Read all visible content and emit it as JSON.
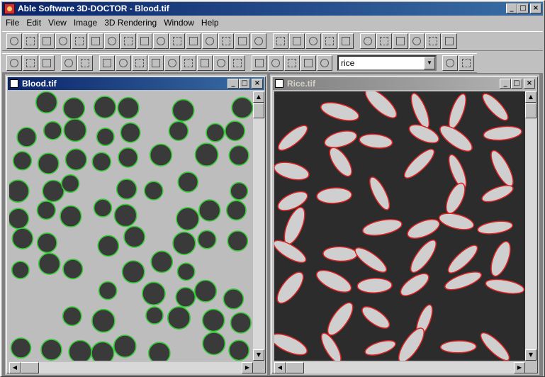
{
  "app": {
    "title": "Able Software 3D-DOCTOR - Blood.tif"
  },
  "window_buttons": {
    "minimize": "_",
    "maximize": "□",
    "close": "×"
  },
  "menu": [
    "File",
    "Edit",
    "View",
    "Image",
    "3D Rendering",
    "Window",
    "Help"
  ],
  "toolbar1": [
    "select-region-tool",
    "rectangle-tool",
    "ellipse-tool",
    "vertical-tool",
    "horizontal-tool",
    "polyline-tool",
    "move-tool",
    "transform-tool",
    "rectangle-select-tool",
    "polygon-edit-tool",
    "contour-edit-tool",
    "delete-tool",
    "erase-tool",
    "ruler-tool",
    "measure-tool",
    "edit-tool",
    "pencil-tool",
    "grid-tool",
    "fill-tool",
    "palette-tool",
    "table-tool",
    "region-select-tool",
    "pentagon-tool",
    "square-tool",
    "circle-tool",
    "remove-tool",
    "cursor-select-tool"
  ],
  "toolbar2": [
    "new-icon",
    "open-folder-icon",
    "save-icon",
    "edit-icon",
    "pointer-icon",
    "zoom-in-icon",
    "zoom-out-icon",
    "pan-icon",
    "arrow-left-icon",
    "arrow-right-icon",
    "arrow-up-icon",
    "arrow-down-icon",
    "undo-icon",
    "redo-icon",
    "segment-icon",
    "boundary-icon",
    "link-icon",
    "text-icon",
    "scale-icon"
  ],
  "object_selector": {
    "value": "rice",
    "arrow": "▼"
  },
  "toolbar2_after": [
    "object-settings-icon",
    "help-cursor-icon"
  ],
  "windows": [
    {
      "title": "Blood.tif",
      "state": "active",
      "outline_color": "#33cc33",
      "background": "#bdbdbd",
      "cell_color": "#3a3a3a"
    },
    {
      "title": "Rice.tif",
      "state": "inactive",
      "outline_color": "#dd2222",
      "background": "#2c2c2c",
      "cell_color": "#cfcfcf"
    }
  ],
  "scroll_glyphs": {
    "up": "▲",
    "down": "▼",
    "left": "◀",
    "right": "▶"
  }
}
